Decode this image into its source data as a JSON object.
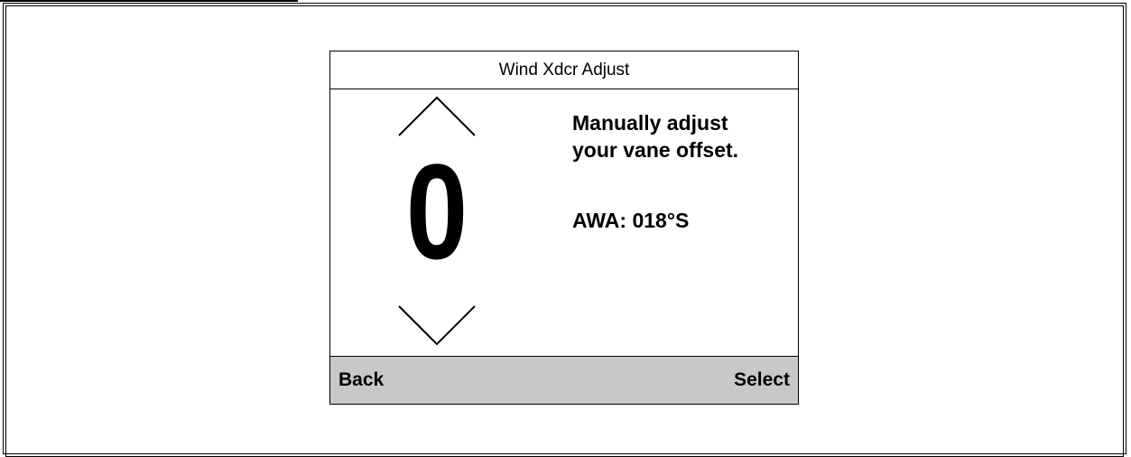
{
  "screen": {
    "title": "Wind Xdcr Adjust",
    "value": "0",
    "instruction_line1": "Manually adjust",
    "instruction_line2": "your vane offset.",
    "awa_readout": "AWA: 018°S"
  },
  "softkeys": {
    "left_label": "Back",
    "right_label": "Select"
  },
  "icons": {
    "increase": "chevron-up-icon",
    "decrease": "chevron-down-icon"
  },
  "colors": {
    "softkey_bar": "#c8c8c8",
    "text": "#000000",
    "background": "#ffffff"
  }
}
